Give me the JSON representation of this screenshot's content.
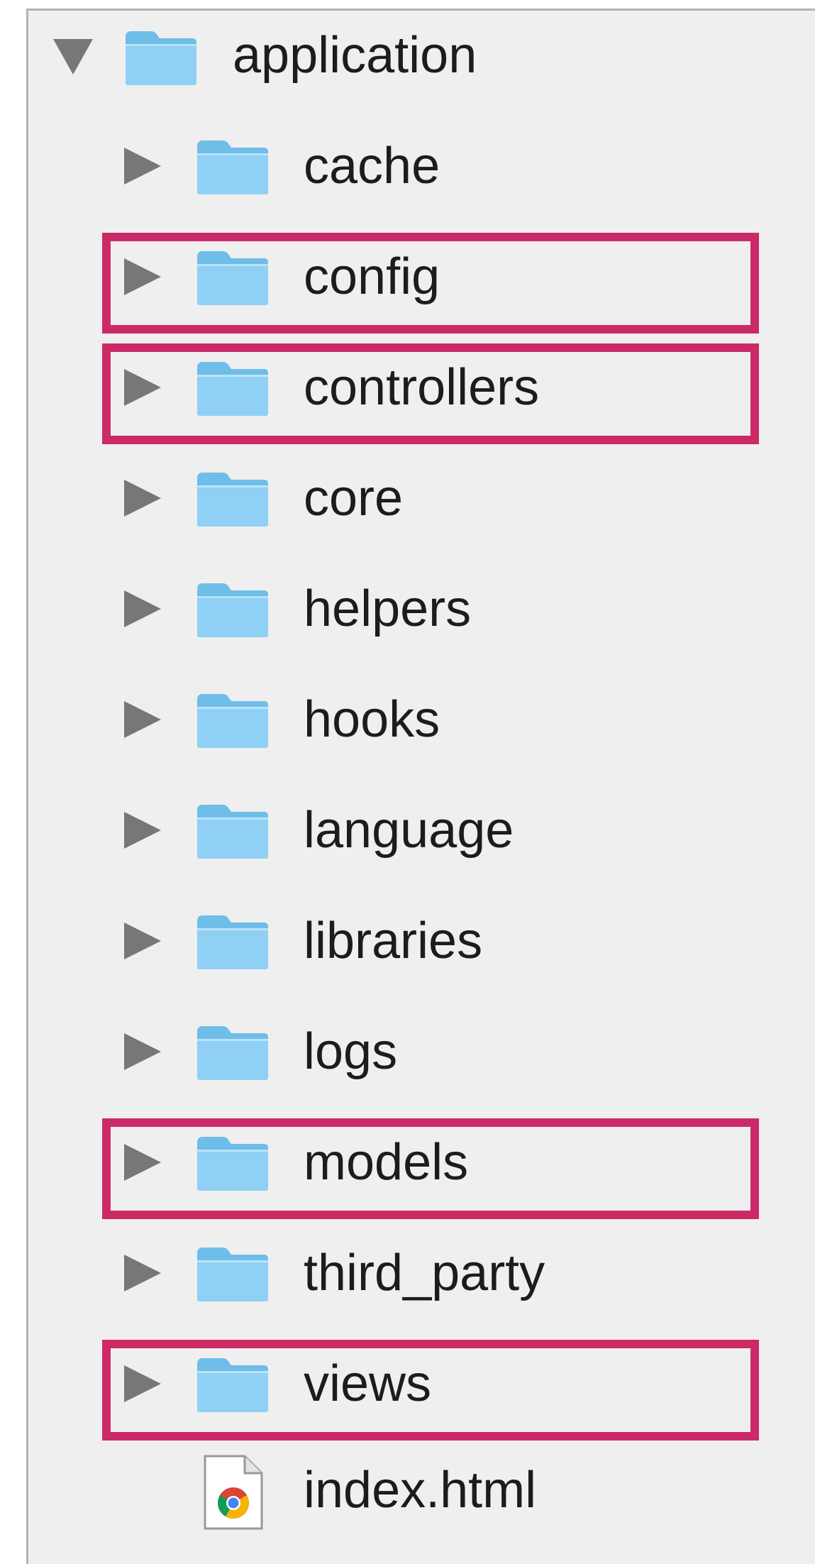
{
  "tree": {
    "root": {
      "label": "application",
      "icon": "folder-icon",
      "expanded": true
    },
    "children": [
      {
        "label": "cache",
        "icon": "folder-icon",
        "highlighted": false
      },
      {
        "label": "config",
        "icon": "folder-icon",
        "highlighted": true
      },
      {
        "label": "controllers",
        "icon": "folder-icon",
        "highlighted": true
      },
      {
        "label": "core",
        "icon": "folder-icon",
        "highlighted": false
      },
      {
        "label": "helpers",
        "icon": "folder-icon",
        "highlighted": false
      },
      {
        "label": "hooks",
        "icon": "folder-icon",
        "highlighted": false
      },
      {
        "label": "language",
        "icon": "folder-icon",
        "highlighted": false
      },
      {
        "label": "libraries",
        "icon": "folder-icon",
        "highlighted": false
      },
      {
        "label": "logs",
        "icon": "folder-icon",
        "highlighted": false
      },
      {
        "label": "models",
        "icon": "folder-icon",
        "highlighted": true
      },
      {
        "label": "third_party",
        "icon": "folder-icon",
        "highlighted": false
      },
      {
        "label": "views",
        "icon": "folder-icon",
        "highlighted": true
      }
    ],
    "file": {
      "label": "index.html",
      "icon": "chrome-html-file-icon"
    }
  },
  "colors": {
    "highlight": "#cc2a66",
    "folder": "#7cc4ee",
    "disclosure": "#777777",
    "panel": "#efefef"
  }
}
